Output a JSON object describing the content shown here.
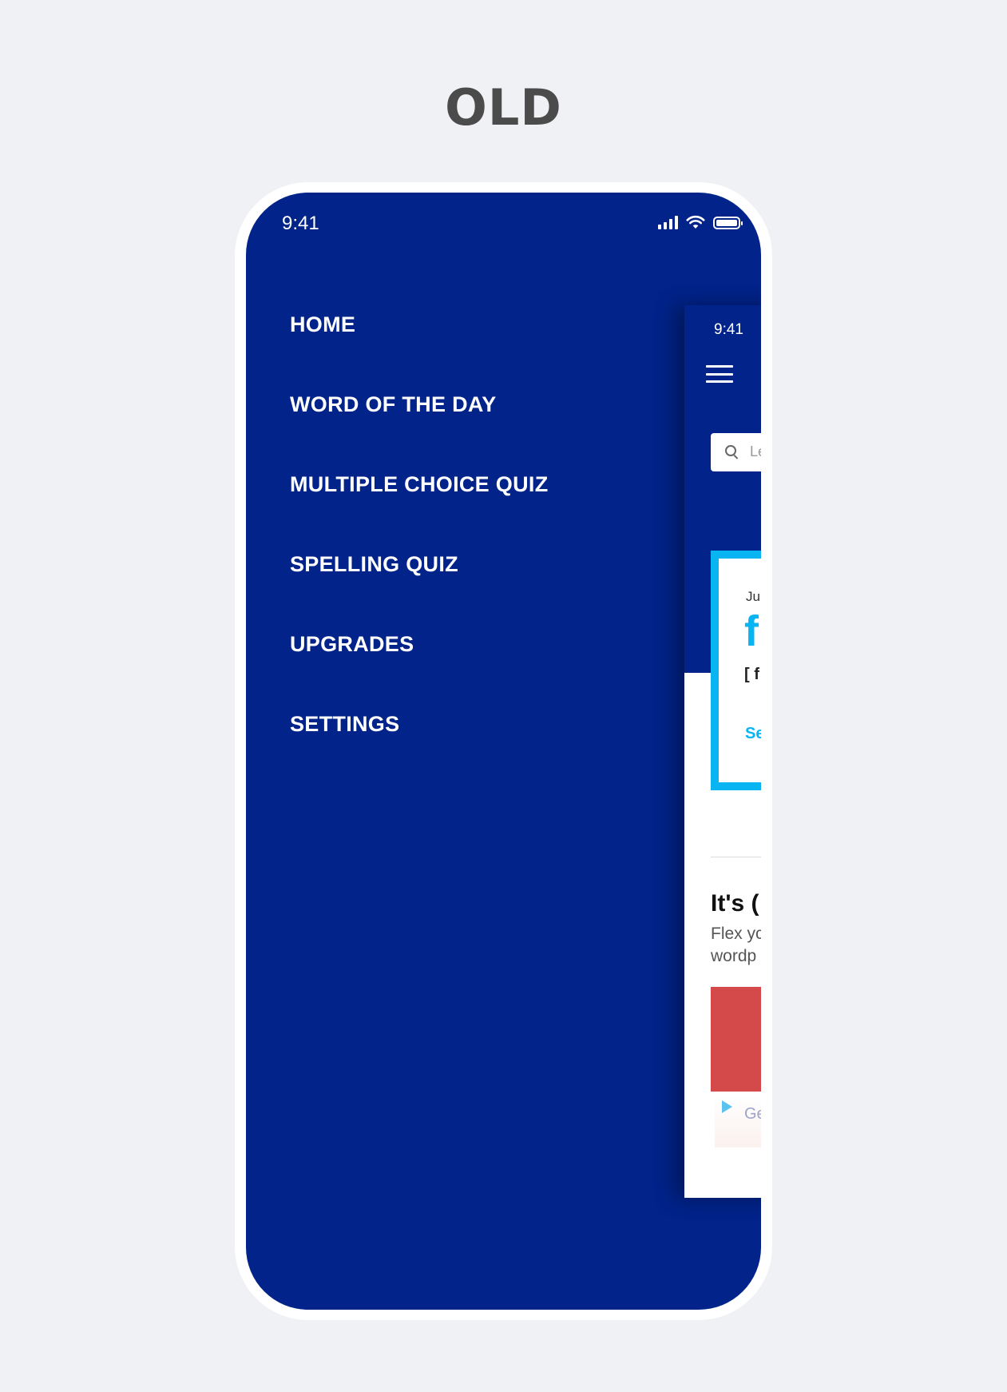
{
  "heading": "OLD",
  "status_bar": {
    "time": "9:41"
  },
  "drawer_menu": {
    "items": [
      {
        "label": "HOME"
      },
      {
        "label": "WORD OF THE DAY"
      },
      {
        "label": "MULTIPLE CHOICE QUIZ"
      },
      {
        "label": "SPELLING QUIZ"
      },
      {
        "label": "UPGRADES"
      },
      {
        "label": "SETTINGS"
      }
    ]
  },
  "preview": {
    "time": "9:41",
    "search_placeholder": "Le",
    "wotd": {
      "date": "Jul",
      "word": "f",
      "pronunciation": "[ f",
      "link": "Se"
    },
    "promo": {
      "title": "It's (",
      "line1": "Flex yc",
      "line2": "wordp"
    },
    "ad_text": "Ge"
  },
  "colors": {
    "drawer_bg": "#01238a",
    "accent": "#09b4f3",
    "promo_image": "#d44a4b",
    "page_bg": "#f0f1f4"
  }
}
